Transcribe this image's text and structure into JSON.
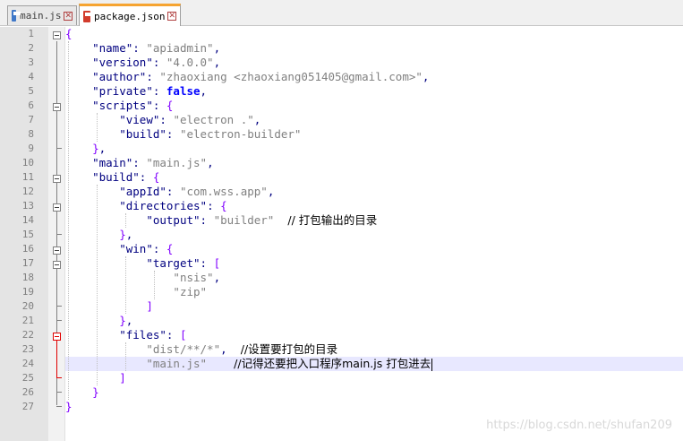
{
  "tabs": [
    {
      "label": "main.js",
      "icon": "js-file-icon",
      "active": false
    },
    {
      "label": "package.json",
      "icon": "json-file-icon",
      "active": true
    }
  ],
  "lines": [
    "1",
    "2",
    "3",
    "4",
    "5",
    "6",
    "7",
    "8",
    "9",
    "10",
    "11",
    "12",
    "13",
    "14",
    "15",
    "16",
    "17",
    "18",
    "19",
    "20",
    "21",
    "22",
    "23",
    "24",
    "25",
    "26",
    "27"
  ],
  "code": {
    "l1": "{",
    "l2_key": "\"name\"",
    "l2_val": "\"apiadmin\"",
    "l3_key": "\"version\"",
    "l3_val": "\"4.0.0\"",
    "l4_key": "\"author\"",
    "l4_val": "\"zhaoxiang <zhaoxiang051405@gmail.com>\"",
    "l5_key": "\"private\"",
    "l5_val": "false",
    "l6_key": "\"scripts\"",
    "l7_key": "\"view\"",
    "l7_val": "\"electron .\"",
    "l8_key": "\"build\"",
    "l8_val": "\"electron-builder\"",
    "l10_key": "\"main\"",
    "l10_val": "\"main.js\"",
    "l11_key": "\"build\"",
    "l12_key": "\"appId\"",
    "l12_val": "\"com.wss.app\"",
    "l13_key": "\"directories\"",
    "l14_key": "\"output\"",
    "l14_val": "\"builder\"",
    "l14_comment": "// 打包输出的目录",
    "l16_key": "\"win\"",
    "l17_key": "\"target\"",
    "l18_val": "\"nsis\"",
    "l19_val": "\"zip\"",
    "l22_key": "\"files\"",
    "l23_val": "\"dist/**/*\"",
    "l23_comment": "//设置要打包的目录",
    "l24_val": "\"main.js\"",
    "l24_comment": "//记得还要把入口程序main.js 打包进去"
  },
  "watermark": "https://blog.csdn.net/shufan209",
  "colors": {
    "string": "#808080",
    "key": "#000080",
    "keyword": "#0000ff",
    "bracket": "#8000ff",
    "comment": "#008000",
    "active_tab_accent": "#f6a431",
    "current_line": "#e8e8ff"
  }
}
